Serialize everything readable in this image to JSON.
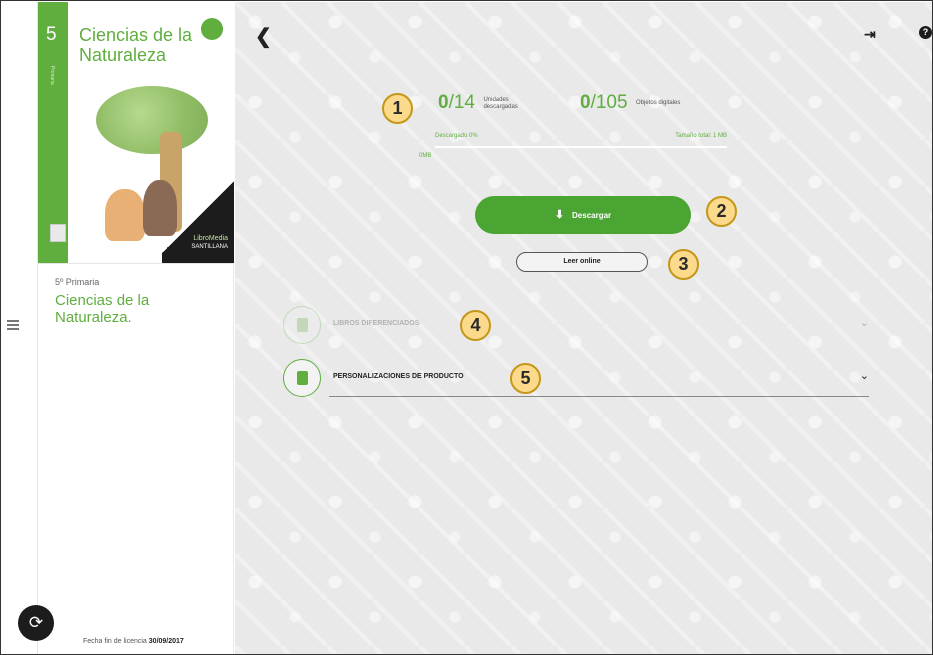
{
  "sidebar": {
    "cover": {
      "grade_number": "5",
      "spine_text": "Primaria",
      "title": "Ciencias de la Naturaleza",
      "brand_top": "LibroMedia",
      "brand_bottom": "SANTILLANA"
    },
    "grade": "5º Primaria",
    "title": "Ciencias de la Naturaleza.",
    "license_label": "Fecha fin de licencia",
    "license_date": "30/09/2017"
  },
  "stats": {
    "units_done": "0",
    "units_total": "/14",
    "units_label": "Unidades descargadas",
    "objects_done": "0",
    "objects_total": "/105",
    "objects_label": "Objetos digitales"
  },
  "progress": {
    "downloaded_label": "Descargado 0%",
    "size_label": "Tamaño total: 1 MB",
    "start_label": "0MB",
    "percent": 0
  },
  "actions": {
    "download": "Descargar",
    "read_online": "Leer online"
  },
  "sections": [
    {
      "title": "LIBROS DIFERENCIADOS",
      "enabled": false
    },
    {
      "title": "PERSONALIZACIONES DE PRODUCTO",
      "enabled": true
    }
  ],
  "markers": [
    "1",
    "2",
    "3",
    "4",
    "5"
  ],
  "colors": {
    "brand_green": "#5fae3e",
    "button_green": "#4aa533",
    "marker_fill": "#fbdb8b",
    "dark": "#1c1c1c"
  },
  "icons": [
    "menu-icon",
    "sync-icon",
    "back-icon",
    "exit-icon",
    "help-icon",
    "download-icon",
    "chevron-down-icon"
  ]
}
